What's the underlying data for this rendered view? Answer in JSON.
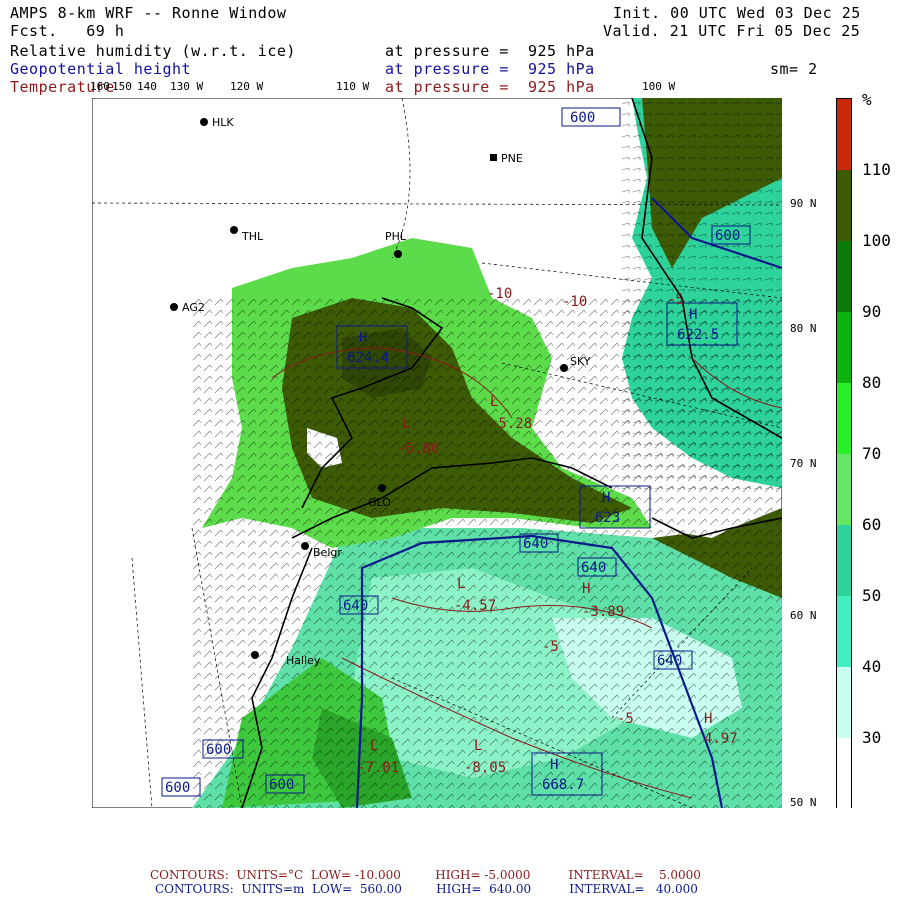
{
  "header": {
    "title": "AMPS 8-km WRF -- Ronne Window",
    "fcst": "Fcst.   69 h",
    "init": "Init. 00 UTC Wed 03 Dec 25",
    "valid": "Valid. 21 UTC Fri 05 Dec 25",
    "field1": "Relative humidity (w.r.t. ice)",
    "field2": "Geopotential height",
    "field3": "Temperature",
    "pressure1": "at pressure =  925 hPa",
    "pressure2": "at pressure =  925 hPa",
    "pressure3": "at pressure =  925 hPa",
    "smoothing": "sm= 2"
  },
  "colorbar": {
    "unit": "%",
    "labels": [
      "110",
      "100",
      "90",
      "80",
      "70",
      "60",
      "50",
      "40",
      "30"
    ],
    "colors": [
      "#c8290a",
      "#3d5a05",
      "#0a7a0a",
      "#0ab40a",
      "#28f028",
      "#62e862",
      "#2ed39c",
      "#40f0c0",
      "#c8fff0",
      "#ffffff"
    ]
  },
  "lon_labels": [
    "160",
    "150",
    "140",
    "130 W",
    "120 W",
    "110 W",
    "100 W"
  ],
  "lat_labels": [
    "90 N",
    "80 N",
    "70 N",
    "60 N",
    "50 N"
  ],
  "stations": [
    {
      "name": "HLK"
    },
    {
      "name": "PNE"
    },
    {
      "name": "THL"
    },
    {
      "name": "PHL"
    },
    {
      "name": "AG2"
    },
    {
      "name": "SKY"
    },
    {
      "name": "GLO"
    },
    {
      "name": "Belgr"
    },
    {
      "name": "Halley"
    }
  ],
  "height_labels": [
    "600",
    "600",
    "600",
    "600",
    "640",
    "640",
    "640",
    "640",
    "600",
    "600"
  ],
  "extrema": [
    {
      "mark": "H",
      "value": "622.5"
    },
    {
      "mark": "H",
      "value": "624.4"
    },
    {
      "mark": "H",
      "value": "623"
    },
    {
      "mark": "H",
      "value": "668.7"
    },
    {
      "mark": "L",
      "value": "-6.80"
    },
    {
      "mark": "H",
      "value": "-3.89"
    },
    {
      "mark": "H",
      "value": "4.97"
    },
    {
      "mark": "L",
      "value": "-7.01"
    },
    {
      "mark": "L",
      "value": "-8.05"
    },
    {
      "mark": "L",
      "value": "-4.57"
    },
    {
      "mark": "L",
      "value": "-5.28"
    }
  ],
  "temp_labels": [
    "-5",
    "-5",
    "-5",
    "-10",
    "-10"
  ],
  "footer": {
    "red_line": "CONTOURS:  UNITS=°C  LOW= -10.000         HIGH= -5.0000          INTERVAL=    5.0000",
    "blue_line": "CONTOURS:  UNITS=m  LOW=  560.00         HIGH=  640.00          INTERVAL=   40.000"
  }
}
